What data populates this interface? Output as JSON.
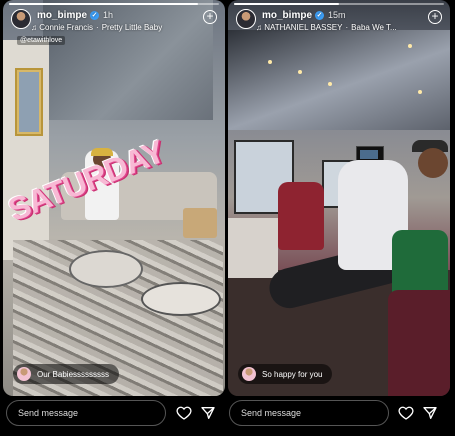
{
  "stories": [
    {
      "username": "mo_bimpe",
      "time": "1h",
      "music": {
        "artist": "Connie Francis",
        "track": "Pretty Little Baby"
      },
      "mention": "@etawithlove",
      "sticker_text": "SATURDAY",
      "reply_text": "Our Babiesssssssss",
      "progress": 0.9
    },
    {
      "username": "mo_bimpe",
      "time": "15m",
      "music": {
        "artist": "NATHANIEL BASSEY",
        "track": "Baba We T..."
      },
      "reply_text": "So happy for you",
      "progress": 0.5
    }
  ],
  "composer": {
    "placeholder": "Send message"
  },
  "icons": [
    "heart-icon",
    "send-icon",
    "add-story-icon",
    "verified-icon",
    "music-icon"
  ],
  "colors": {
    "verified": "#3b9cf4",
    "sticker": "#f7b9d4",
    "sticker_outline": "#e0478f"
  }
}
